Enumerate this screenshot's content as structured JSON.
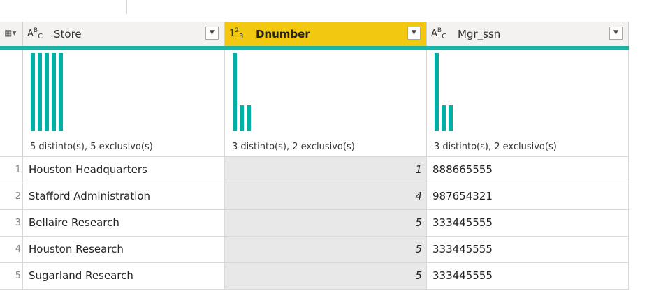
{
  "columns": [
    {
      "name": "Store",
      "type_icon": {
        "a": "A",
        "b": "B",
        "c": "C"
      },
      "stats": "5 distinto(s), 5 exclusivo(s)",
      "selected": false
    },
    {
      "name": "Dnumber",
      "type_icon": {
        "a": "1",
        "b": "2",
        "c": "3"
      },
      "stats": "3 distinto(s), 2 exclusivo(s)",
      "selected": true
    },
    {
      "name": "Mgr_ssn",
      "type_icon": {
        "a": "A",
        "b": "B",
        "c": "C"
      },
      "stats": "3 distinto(s), 2 exclusivo(s)",
      "selected": false
    }
  ],
  "distribution": [
    [
      1,
      1,
      1,
      1,
      1
    ],
    [
      3,
      1,
      1
    ],
    [
      3,
      1,
      1
    ]
  ],
  "rows": [
    {
      "index": "1",
      "store": "Houston Headquarters",
      "dnumber": "1",
      "mgr_ssn": "888665555"
    },
    {
      "index": "2",
      "store": "Stafford Administration",
      "dnumber": "4",
      "mgr_ssn": "987654321"
    },
    {
      "index": "3",
      "store": "Bellaire Research",
      "dnumber": "5",
      "mgr_ssn": "333445555"
    },
    {
      "index": "4",
      "store": "Houston Research",
      "dnumber": "5",
      "mgr_ssn": "333445555"
    },
    {
      "index": "5",
      "store": "Sugarland Research",
      "dnumber": "5",
      "mgr_ssn": "333445555"
    }
  ],
  "colors": {
    "accent_teal": "#1fb3a6",
    "selected_header": "#f2c811",
    "bar": "#00b0a5"
  },
  "icons": {
    "table_menu": "table-menu-icon",
    "dropdown": "chevron-down-icon",
    "text_type": "text-type-icon",
    "number_type": "whole-number-type-icon"
  }
}
